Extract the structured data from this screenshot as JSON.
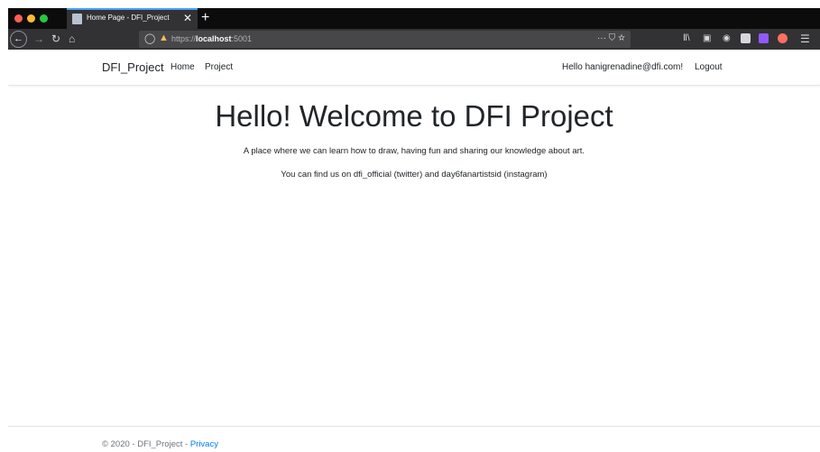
{
  "browser": {
    "tab_title": "Home Page - DFI_Project",
    "tab_close": "✕",
    "new_tab": "+",
    "url_scheme": "https://",
    "url_host": "localhost",
    "url_port": ":5001",
    "url_actions": "··· ⛉ ☆"
  },
  "navbar": {
    "brand": "DFI_Project",
    "links": [
      "Home",
      "Project"
    ],
    "greeting": "Hello hanigrenadine@dfi.com!",
    "logout": "Logout"
  },
  "main": {
    "title": "Hello! Welcome to DFI Project",
    "tagline": "A place where we can learn how to draw, having fun and sharing our knowledge about art.",
    "social": "You can find us on dfi_official (twitter) and day6fanartistsid (instagram)"
  },
  "footer": {
    "copyright": "© 2020 - DFI_Project - ",
    "privacy": "Privacy"
  },
  "colors": {
    "link": "#007bff",
    "tab_accent": "#45a1ff"
  }
}
